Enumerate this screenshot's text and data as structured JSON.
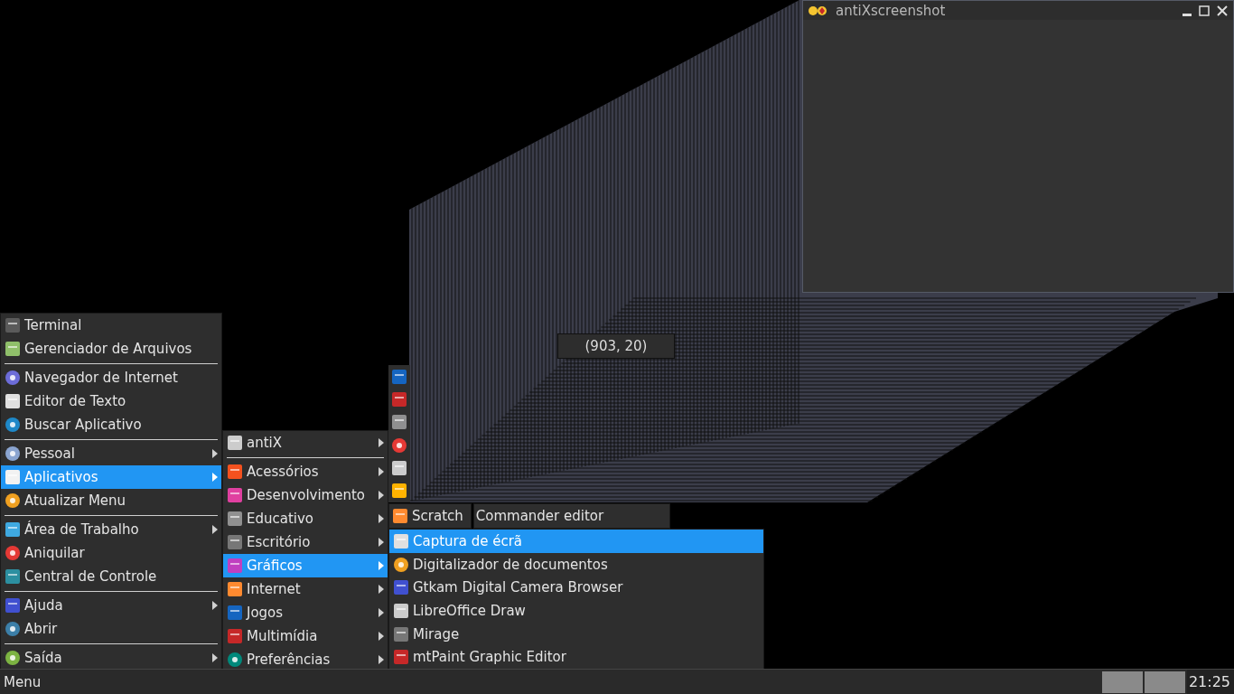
{
  "window": {
    "title": "antiXscreenshot"
  },
  "coordinates_tooltip": "(903, 20)",
  "main_menu": {
    "sections": [
      {
        "items": [
          {
            "label": "Terminal",
            "submenu": false,
            "selected": false
          },
          {
            "label": "Gerenciador de Arquivos",
            "submenu": false,
            "selected": false
          }
        ]
      },
      {
        "items": [
          {
            "label": "Navegador de Internet",
            "submenu": false,
            "selected": false
          },
          {
            "label": "Editor de Texto",
            "submenu": false,
            "selected": false
          },
          {
            "label": "Buscar Aplicativo",
            "submenu": false,
            "selected": false
          }
        ]
      },
      {
        "items": [
          {
            "label": "Pessoal",
            "submenu": true,
            "selected": false
          },
          {
            "label": "Aplicativos",
            "submenu": true,
            "selected": true
          },
          {
            "label": "Atualizar Menu",
            "submenu": false,
            "selected": false
          }
        ]
      },
      {
        "items": [
          {
            "label": "Área de Trabalho",
            "submenu": true,
            "selected": false
          },
          {
            "label": "Aniquilar",
            "submenu": false,
            "selected": false
          },
          {
            "label": "Central de Controle",
            "submenu": false,
            "selected": false
          }
        ]
      },
      {
        "items": [
          {
            "label": "Ajuda",
            "submenu": true,
            "selected": false
          },
          {
            "label": "Abrir",
            "submenu": false,
            "selected": false
          }
        ]
      },
      {
        "items": [
          {
            "label": "Saída",
            "submenu": true,
            "selected": false
          }
        ]
      }
    ]
  },
  "applications_menu": {
    "sections": [
      {
        "items": [
          {
            "label": "antiX",
            "submenu": true,
            "selected": false
          }
        ]
      },
      {
        "items": [
          {
            "label": "Acessórios",
            "submenu": true,
            "selected": false
          },
          {
            "label": "Desenvolvimento",
            "submenu": true,
            "selected": false
          },
          {
            "label": "Educativo",
            "submenu": true,
            "selected": false
          },
          {
            "label": "Escritório",
            "submenu": true,
            "selected": false
          },
          {
            "label": "Gráficos",
            "submenu": true,
            "selected": true
          },
          {
            "label": "Internet",
            "submenu": true,
            "selected": false
          },
          {
            "label": "Jogos",
            "submenu": true,
            "selected": false
          },
          {
            "label": "Multimídia",
            "submenu": true,
            "selected": false
          },
          {
            "label": "Preferências",
            "submenu": true,
            "selected": false
          }
        ]
      }
    ]
  },
  "leftover_menu": {
    "items": [
      {
        "label": "Scratch"
      },
      {
        "label": "Commander editor"
      }
    ]
  },
  "graphics_menu": {
    "items": [
      {
        "label": "Captura de écrã",
        "selected": true
      },
      {
        "label": "Digitalizador de documentos",
        "selected": false
      },
      {
        "label": "Gtkam Digital Camera Browser",
        "selected": false
      },
      {
        "label": "LibreOffice Draw",
        "selected": false
      },
      {
        "label": "Mirage",
        "selected": false
      },
      {
        "label": "mtPaint Graphic Editor",
        "selected": false
      }
    ]
  },
  "taskbar": {
    "menu_label": "Menu",
    "clock": "21:25"
  }
}
